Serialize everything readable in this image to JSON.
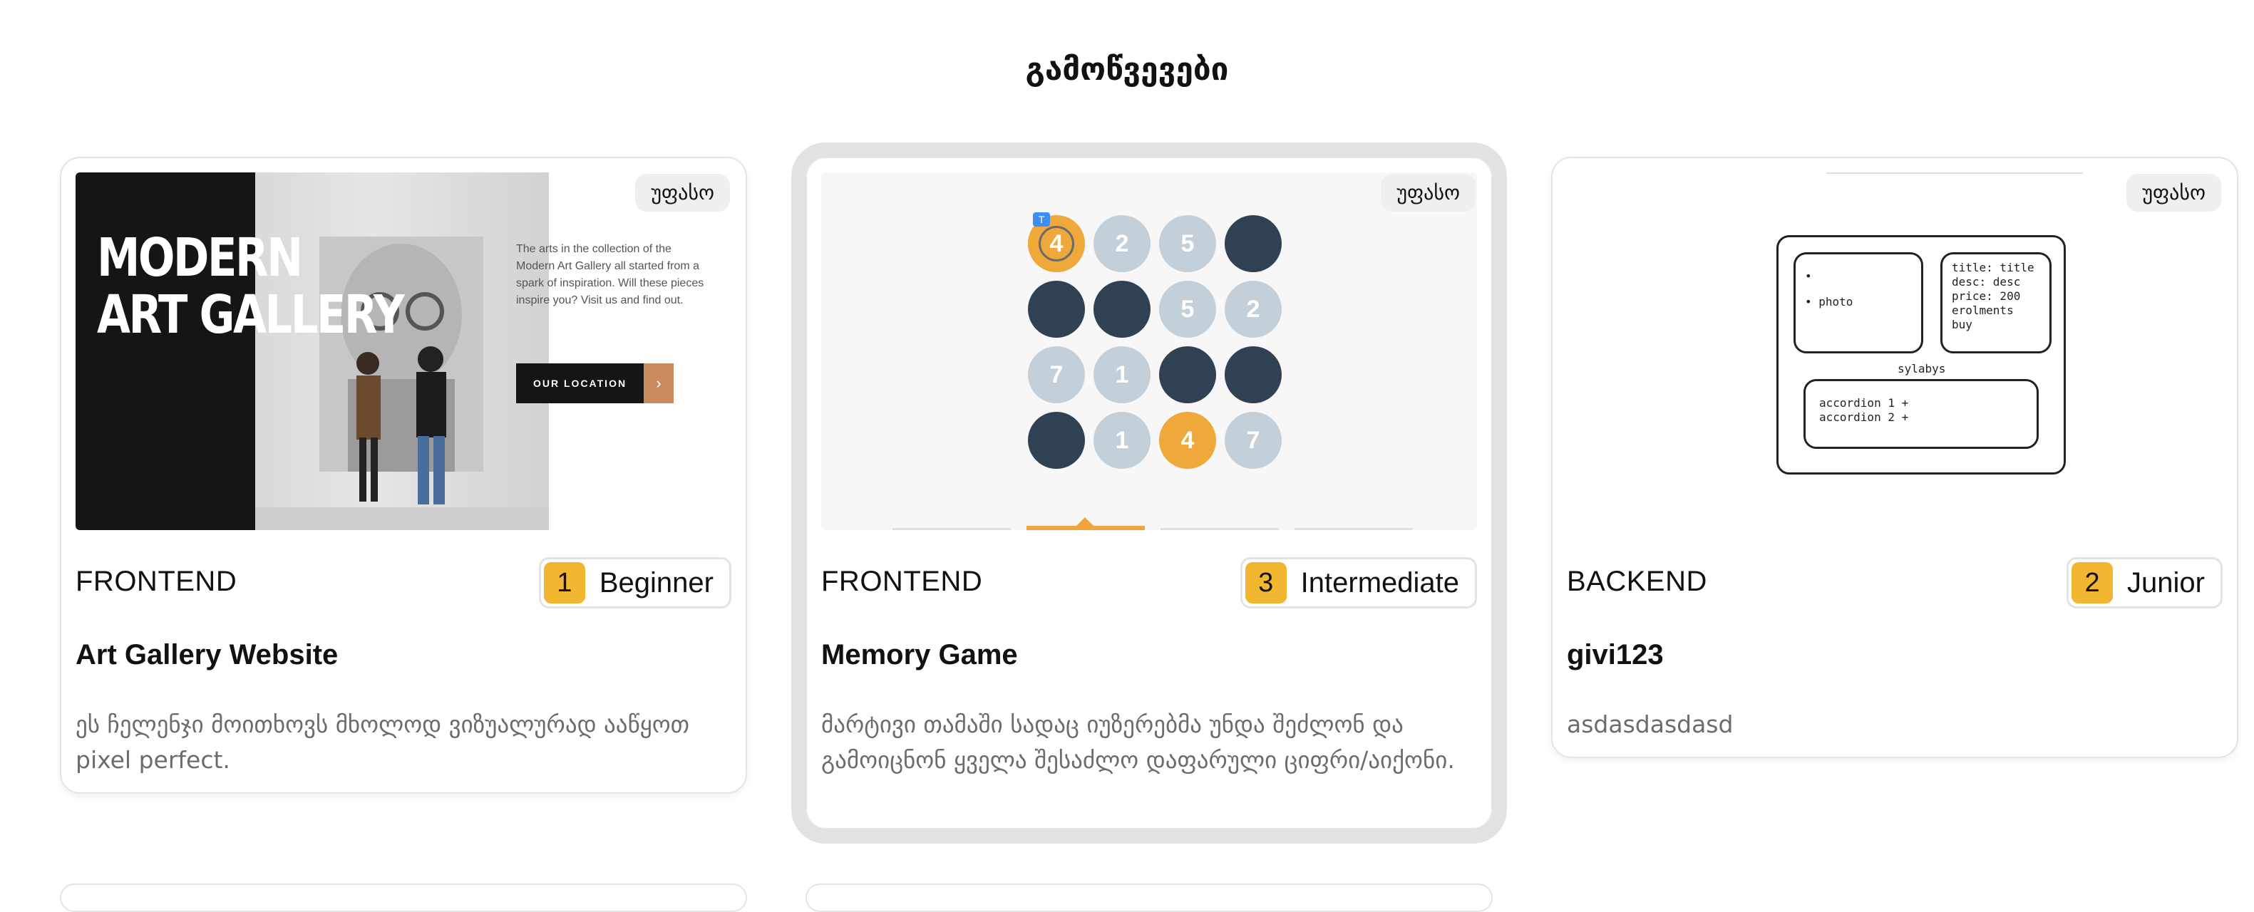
{
  "page": {
    "title": "გამოწვევები"
  },
  "cards": [
    {
      "price": "უფასო",
      "category": "FRONTEND",
      "level_num": "1",
      "level_label": "Beginner",
      "title": "Art Gallery Website",
      "description": "ეს ჩელენჯი მოითხოვს მხოლოდ ვიზუალურად ააწყოთ pixel perfect.",
      "thumb": {
        "headline_1": "MODERN",
        "headline_2": "ART GALLERY",
        "body": "The arts in the collection of the Modern Art Gallery all started from a spark of inspiration. Will these pieces inspire you? Visit us and find out.",
        "button": "OUR LOCATION",
        "button_arrow": "›"
      }
    },
    {
      "price": "უფასო",
      "category": "FRONTEND",
      "level_num": "3",
      "level_label": "Intermediate",
      "title": "Memory Game",
      "description": "მარტივი თამაში სადაც იუზერებმა უნდა შეძლონ და გამოიცნონ ყველა შესაძლო დაფარული ციფრი/აიქონი.",
      "thumb": {
        "cells": [
          {
            "v": "4",
            "s": "orange"
          },
          {
            "v": "2",
            "s": "light"
          },
          {
            "v": "5",
            "s": "light"
          },
          {
            "v": "",
            "s": "dark"
          },
          {
            "v": "",
            "s": "dark"
          },
          {
            "v": "",
            "s": "dark"
          },
          {
            "v": "5",
            "s": "light"
          },
          {
            "v": "2",
            "s": "light"
          },
          {
            "v": "7",
            "s": "light"
          },
          {
            "v": "1",
            "s": "light"
          },
          {
            "v": "",
            "s": "dark"
          },
          {
            "v": "",
            "s": "dark"
          },
          {
            "v": "",
            "s": "dark"
          },
          {
            "v": "1",
            "s": "light"
          },
          {
            "v": "4",
            "s": "orange"
          },
          {
            "v": "7",
            "s": "light"
          }
        ]
      }
    },
    {
      "price": "უფასო",
      "category": "BACKEND",
      "level_num": "2",
      "level_label": "Junior",
      "title": "givi123",
      "description": "asdasdasdasd",
      "thumb": {
        "bullet_1": "•",
        "bullet_2": "• photo",
        "info_lines": [
          "title: title",
          "desc: desc",
          "price: 200",
          "erolments",
          "buy"
        ],
        "syllabus": "sylabys",
        "accordion_lines": [
          "accordion 1 +",
          "accordion 2 +"
        ]
      }
    }
  ],
  "colors": {
    "level_badge": "#f2b731",
    "memory_orange": "#efa83a",
    "memory_dark": "#2f4152",
    "memory_light": "#c3d0da"
  }
}
